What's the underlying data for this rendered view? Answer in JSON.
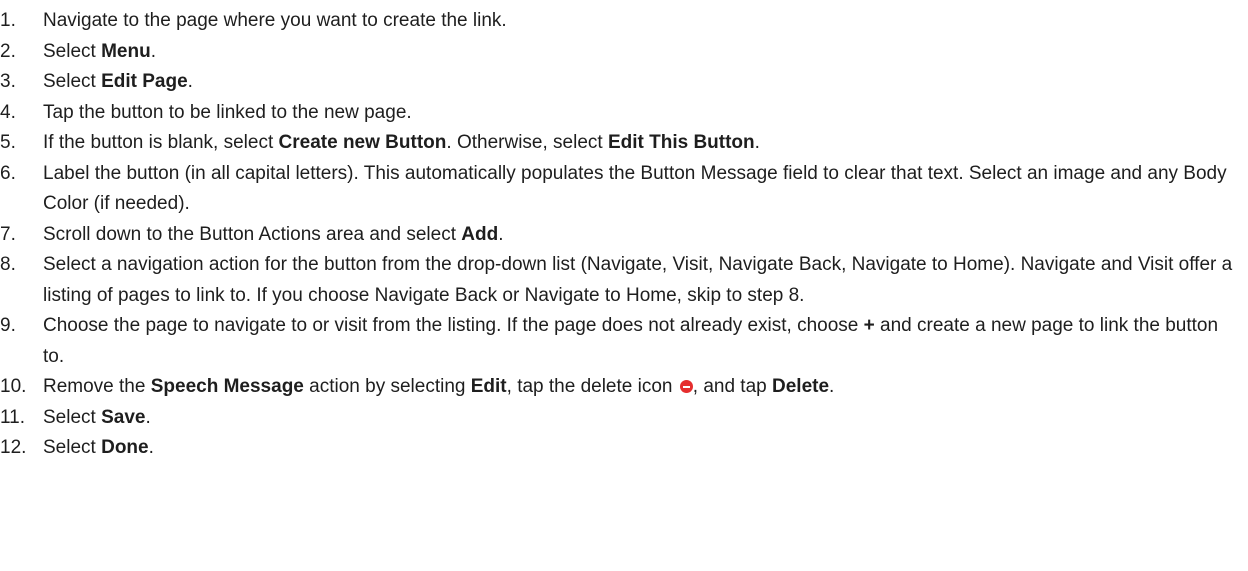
{
  "steps": [
    {
      "num": "1.",
      "parts": [
        {
          "t": "Navigate to the page where you want to create the link."
        }
      ]
    },
    {
      "num": "2.",
      "parts": [
        {
          "t": "Select "
        },
        {
          "t": "Menu",
          "b": true
        },
        {
          "t": "."
        }
      ]
    },
    {
      "num": "3.",
      "parts": [
        {
          "t": "Select "
        },
        {
          "t": "Edit Page",
          "b": true
        },
        {
          "t": "."
        }
      ]
    },
    {
      "num": "4.",
      "parts": [
        {
          "t": "Tap the button to be linked to the new page."
        }
      ]
    },
    {
      "num": "5.",
      "parts": [
        {
          "t": "If the button is blank, select "
        },
        {
          "t": "Create new Button",
          "b": true
        },
        {
          "t": ". Otherwise, select "
        },
        {
          "t": "Edit This Button",
          "b": true
        },
        {
          "t": "."
        }
      ]
    },
    {
      "num": "6.",
      "parts": [
        {
          "t": "Label the button (in all capital letters). This automatically populates the Button Message field to clear that text. Select an image and any Body Color (if needed)."
        }
      ]
    },
    {
      "num": "7.",
      "parts": [
        {
          "t": "Scroll down to the Button Actions area and select "
        },
        {
          "t": "Add",
          "b": true
        },
        {
          "t": "."
        }
      ]
    },
    {
      "num": "8.",
      "parts": [
        {
          "t": "Select a navigation action for the button from the drop-down list (Navigate, Visit, Navigate Back, Navigate to Home). Navigate and Visit offer a listing of pages to link to. If you choose Navigate Back or Navigate to Home, skip to step 8."
        }
      ]
    },
    {
      "num": "9.",
      "parts": [
        {
          "t": "Choose the page to navigate to or visit from the listing. If the page does not already exist, choose "
        },
        {
          "t": "+",
          "b": true
        },
        {
          "t": " and create a new page to link the button to."
        }
      ]
    },
    {
      "num": "10.",
      "parts": [
        {
          "t": "Remove the "
        },
        {
          "t": "Speech Message",
          "b": true
        },
        {
          "t": " action by selecting "
        },
        {
          "t": "Edit",
          "b": true
        },
        {
          "t": ", tap the delete icon "
        },
        {
          "icon": "delete-icon"
        },
        {
          "t": ", and tap "
        },
        {
          "t": "Delete",
          "b": true
        },
        {
          "t": "."
        }
      ]
    },
    {
      "num": "11.",
      "parts": [
        {
          "t": "Select "
        },
        {
          "t": "Save",
          "b": true
        },
        {
          "t": "."
        }
      ]
    },
    {
      "num": "12.",
      "parts": [
        {
          "t": "Select "
        },
        {
          "t": "Done",
          "b": true
        },
        {
          "t": "."
        }
      ]
    }
  ],
  "colors": {
    "text": "#1e1e1e",
    "delete_icon": "#e52e2e"
  }
}
